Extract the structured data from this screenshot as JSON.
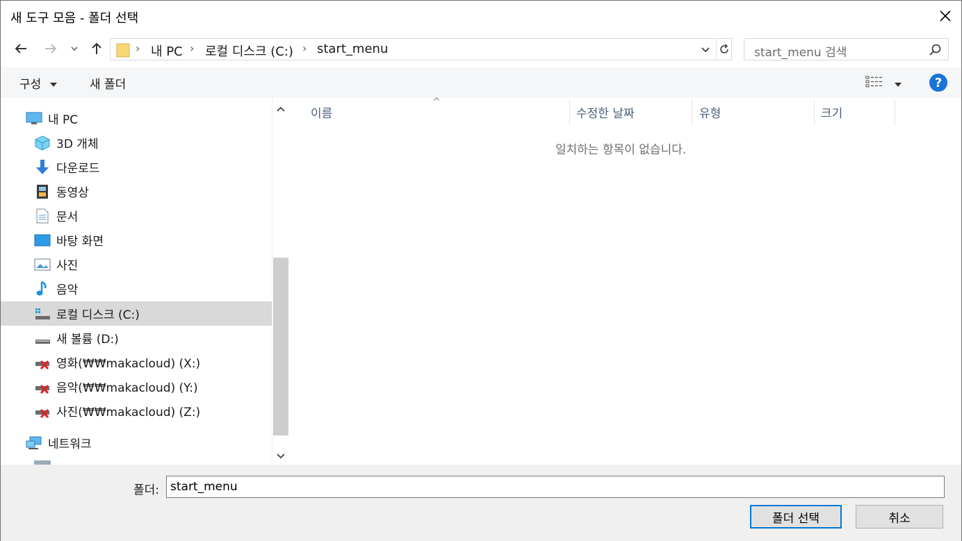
{
  "window": {
    "title": "새 도구 모음 - 폴더 선택"
  },
  "address_bar": {
    "crumbs": [
      "내 PC",
      "로컬 디스크 (C:)",
      "start_menu"
    ]
  },
  "search": {
    "placeholder": "start_menu 검색"
  },
  "command_bar": {
    "organize": "구성",
    "new_folder": "새 폴더"
  },
  "nav_tree": {
    "items": [
      {
        "label": "내 PC",
        "icon": "computer-icon"
      },
      {
        "label": "3D 개체",
        "icon": "3d-objects-icon"
      },
      {
        "label": "다운로드",
        "icon": "download-icon"
      },
      {
        "label": "동영상",
        "icon": "video-icon"
      },
      {
        "label": "문서",
        "icon": "document-icon"
      },
      {
        "label": "바탕 화면",
        "icon": "desktop-icon"
      },
      {
        "label": "사진",
        "icon": "pictures-icon"
      },
      {
        "label": "음악",
        "icon": "music-icon"
      },
      {
        "label": "로컬 디스크 (C:)",
        "icon": "local-disk-icon",
        "selected": true
      },
      {
        "label": "새 볼륨 (D:)",
        "icon": "drive-icon"
      },
      {
        "label": "영화(₩₩makacloud) (X:)",
        "icon": "network-drive-disconnected-icon"
      },
      {
        "label": "음악(₩₩makacloud) (Y:)",
        "icon": "network-drive-disconnected-icon"
      },
      {
        "label": "사진(₩₩makacloud) (Z:)",
        "icon": "network-drive-disconnected-icon"
      },
      {
        "label": "네트워크",
        "icon": "network-icon"
      }
    ]
  },
  "columns": {
    "name": "이름",
    "modified": "수정한 날짜",
    "type": "유형",
    "size": "크기"
  },
  "content": {
    "empty_message": "일치하는 항목이 없습니다."
  },
  "footer": {
    "folder_label": "폴더:",
    "folder_value": "start_menu",
    "select_button": "폴더 선택",
    "cancel_button": "취소"
  },
  "colors": {
    "accent": "#0078d7",
    "help": "#1a73d9",
    "selected_row": "#d9d9d9",
    "column_header_text": "#4c607a"
  }
}
